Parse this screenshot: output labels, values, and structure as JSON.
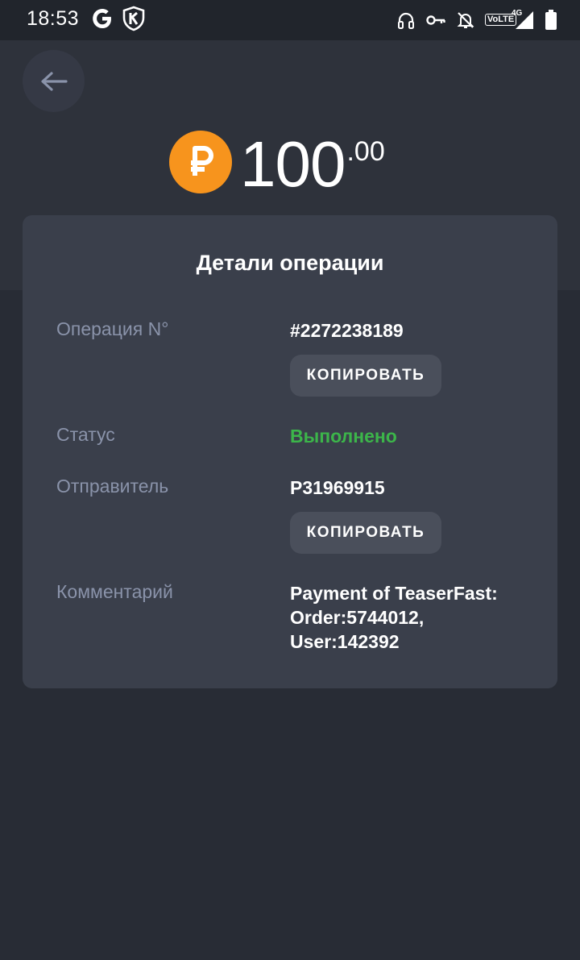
{
  "status_bar": {
    "time": "18:53",
    "network_label": "VoLTE",
    "network_gen": "4G"
  },
  "header": {
    "currency_symbol": "₽",
    "amount_int": "100",
    "amount_dec": ".00"
  },
  "details": {
    "title": "Детали операции",
    "operation": {
      "label": "Операция N°",
      "value": "#2272238189",
      "copy_label": "КОПИРОВАТЬ"
    },
    "status": {
      "label": "Статус",
      "value": "Выполнено"
    },
    "sender": {
      "label": "Отправитель",
      "value": "P31969915",
      "copy_label": "КОПИРОВАТЬ"
    },
    "comment": {
      "label": "Комментарий",
      "lines": [
        "Payment of TeaserFast:",
        "Order:5744012,",
        "User:142392"
      ]
    }
  },
  "colors": {
    "background": "#282c35",
    "card": "#3a3f4b",
    "accent_coin": "#f7941d",
    "status_success": "#3cb54a",
    "label": "#8a93aa"
  }
}
